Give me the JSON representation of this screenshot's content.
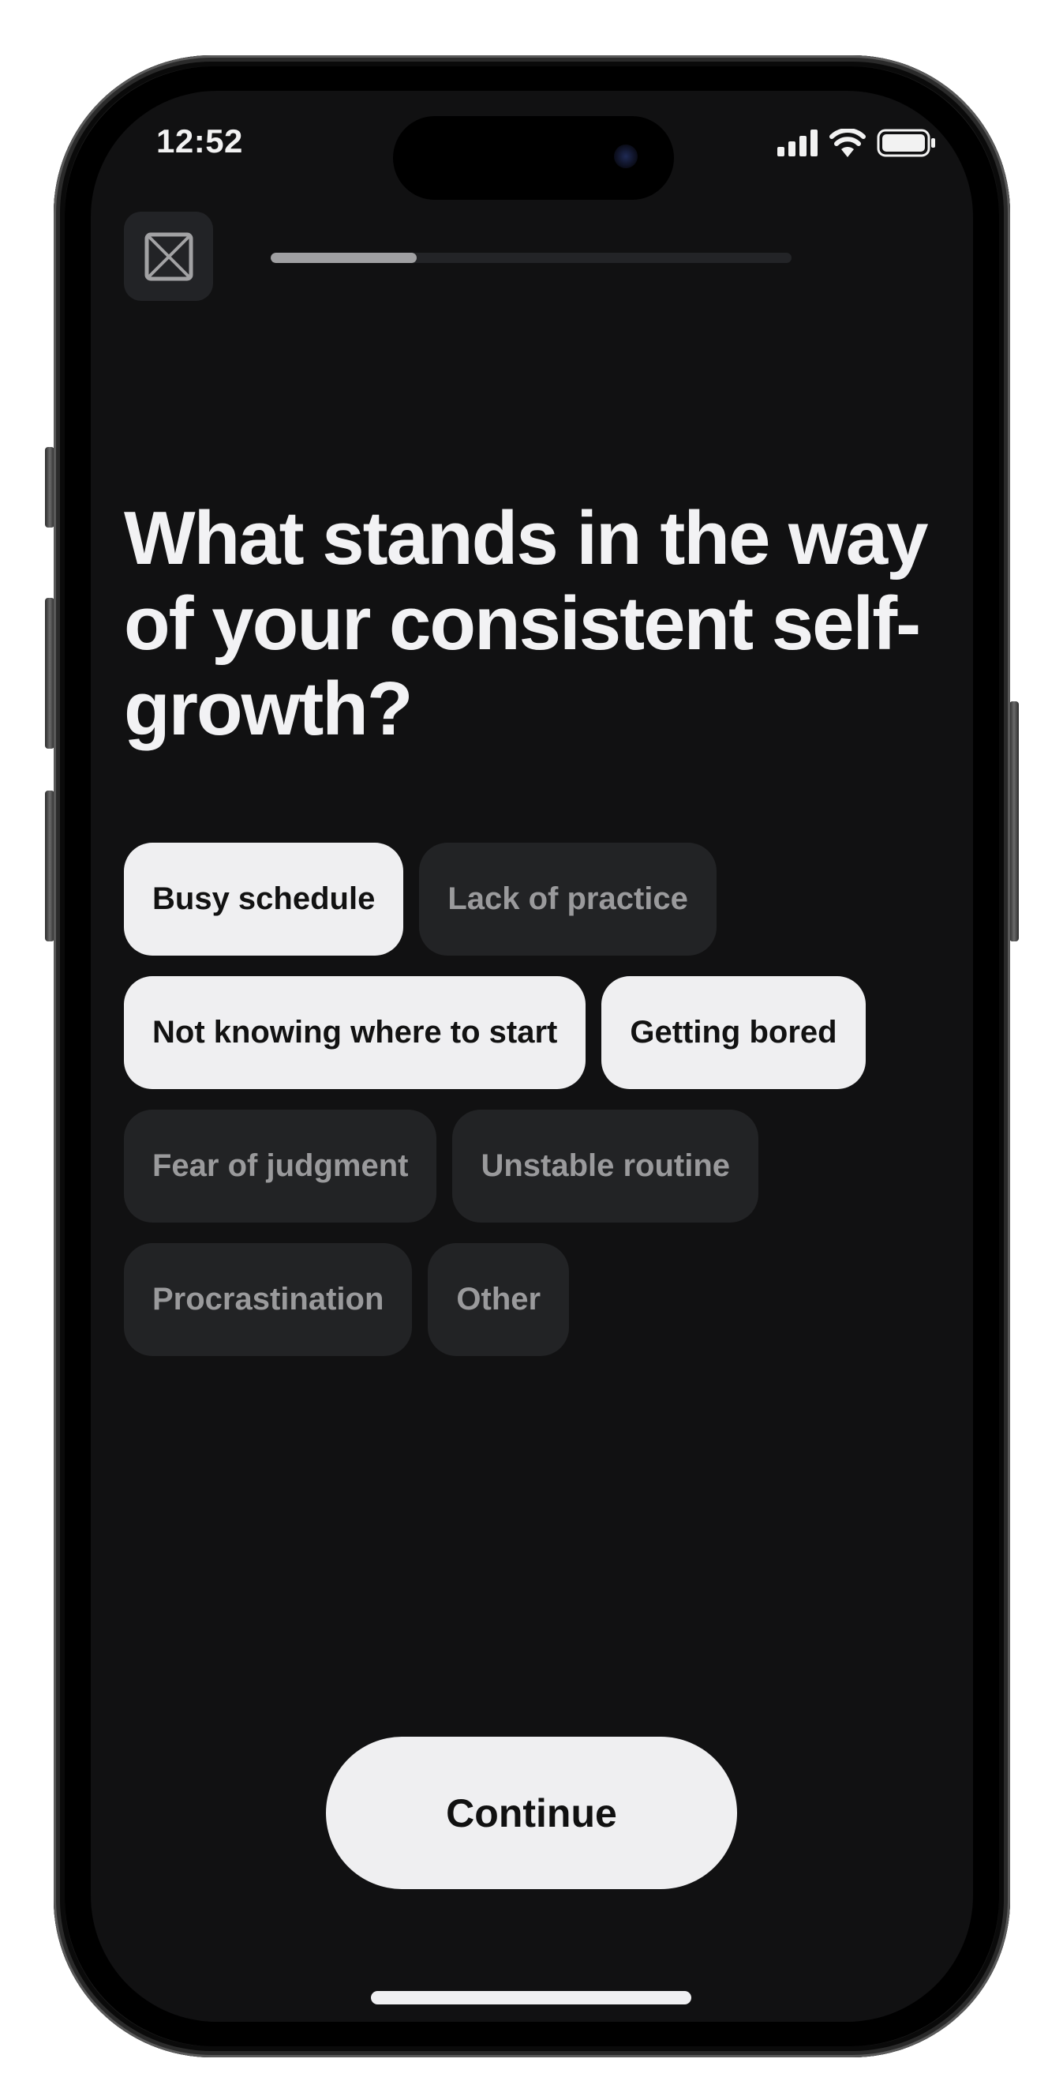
{
  "status_bar": {
    "time": "12:52",
    "icons": [
      "cellular-signal-icon",
      "wifi-icon",
      "battery-icon"
    ]
  },
  "header": {
    "close_icon": "close-box-icon",
    "progress_fraction": 0.28
  },
  "question": {
    "title": "What stands in the way of your consistent self-growth?"
  },
  "options": [
    {
      "label": "Busy schedule",
      "selected": true
    },
    {
      "label": "Lack of practice",
      "selected": false
    },
    {
      "label": "Not knowing where to start",
      "selected": true
    },
    {
      "label": "Getting bored",
      "selected": true
    },
    {
      "label": "Fear of judgment",
      "selected": false
    },
    {
      "label": "Unstable routine",
      "selected": false
    },
    {
      "label": "Procrastination",
      "selected": false
    },
    {
      "label": "Other",
      "selected": false
    }
  ],
  "footer": {
    "continue_label": "Continue"
  },
  "colors": {
    "background": "#111112",
    "chip_selected": "#efeff1",
    "chip_unselected": "#222325",
    "chip_unselected_text": "#9a9a9c",
    "progress_fill": "#a0a0a2",
    "progress_track": "#232427"
  }
}
